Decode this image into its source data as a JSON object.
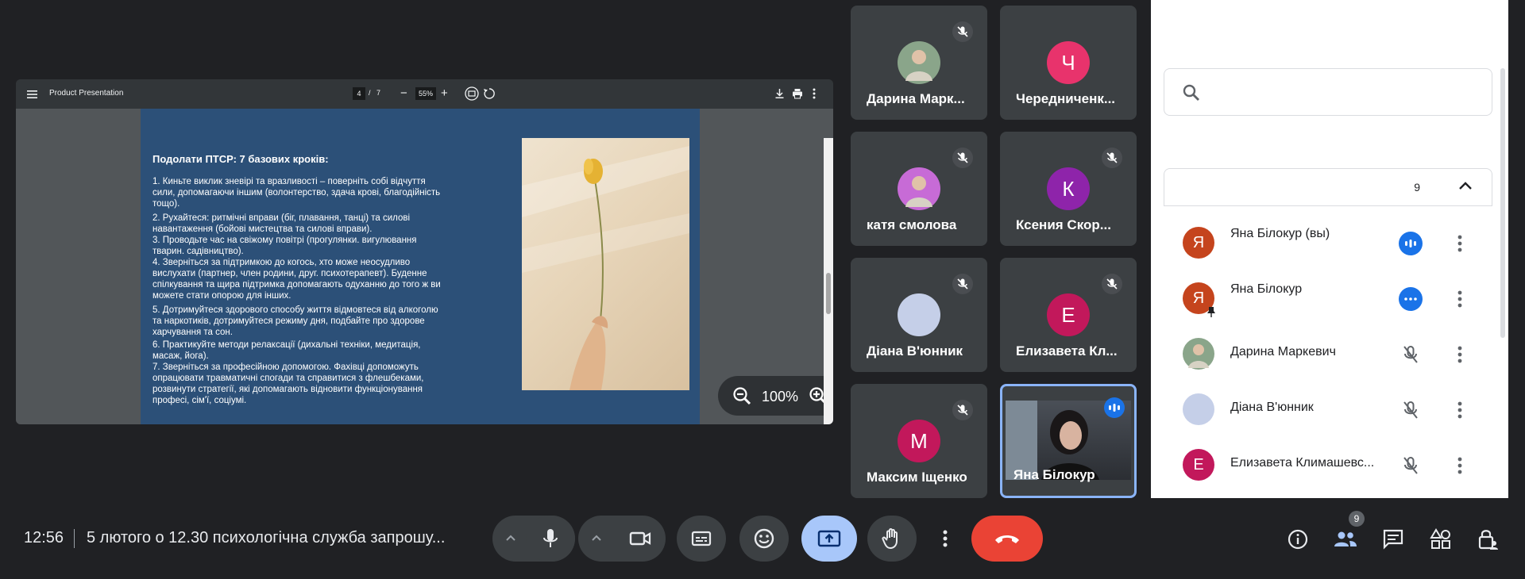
{
  "presentation": {
    "title": "Product Presentation",
    "page_current": "4",
    "page_separator": "/",
    "page_total": "7",
    "zoom_percent": "55%",
    "viewer_zoom": "100%",
    "slide_heading": "Подолати ПТСР: 7 базових кроків:",
    "slide_lines": [
      "1. Киньте виклик зневірі та вразливості – поверніть собі відчуття",
      "сили, допомагаючи іншим (волонтерство, здача крові, благодійність",
      "тощо).",
      "2. Рухайтеся: ритмічні вправи (біг, плавання, танці) та силові",
      "навантаження (бойові мистецтва та силові вправи).",
      "3. Проводьте час на свіжому повітрі (прогулянки. вигулювання",
      "тварин. садівництво).",
      "4. Зверніться за підтримкою до когось, хто може неосудливо",
      "вислухати (партнер, член родини, друг. психотерапевт). Буденне",
      "спілкування та щира підтримка допомагають одуханню до того ж ви",
      "можете стати опорою для інших.",
      "5. Дотримуйтеся здорового способу життя  відмовтеся від алкоголю",
      "та наркотиків, дотримуйтеся режиму дня, подбайте про здорове",
      "харчування та сон.",
      "6. Практикуйте методи релаксації (дихальні техніки, медитація,",
      "масаж, йога).",
      "7. Зверніться за професійною допомогою. Фахівці допоможуть",
      "опрацювати травматичні спогади та справитися з флешбеками,",
      "розвинути  стратегії, які допомагають відновити функціонування",
      "професі, сім'ї, соціумі."
    ]
  },
  "tiles": [
    {
      "name": "Дарина Марк...",
      "initial": "",
      "avatar_color": "#8aa58a",
      "has_photo": true,
      "muted": true
    },
    {
      "name": "Чередниченк...",
      "initial": "Ч",
      "avatar_color": "#e8336c",
      "muted": false
    },
    {
      "name": "катя смолова",
      "initial": "",
      "avatar_color": "#c76bd6",
      "has_photo": true,
      "muted": true
    },
    {
      "name": "Ксения Скор...",
      "initial": "К",
      "avatar_color": "#8e24aa",
      "muted": true
    },
    {
      "name": "Діана В'юнник",
      "initial": "",
      "avatar_color": "#c5cfe8",
      "muted": true
    },
    {
      "name": "Елизавета Кл...",
      "initial": "Е",
      "avatar_color": "#c2185b",
      "muted": true
    },
    {
      "name": "Максим Іщенко",
      "initial": "М",
      "avatar_color": "#c2185b",
      "muted": true
    },
    {
      "name": "Яна Білокур",
      "initial": "",
      "avatar_color": "#333",
      "has_video": true,
      "speaking": true
    }
  ],
  "panel": {
    "group_count": "9",
    "participants": [
      {
        "name": "Яна Білокур (вы)",
        "initial": "Я",
        "color": "#c5441d",
        "status": "speaking"
      },
      {
        "name": "Яна Білокур",
        "initial": "Я",
        "color": "#c5441d",
        "status": "more",
        "pinned": true
      },
      {
        "name": "Дарина Маркевич",
        "initial": "",
        "color": "#8aa58a",
        "status": "muted",
        "photo": true
      },
      {
        "name": "Діана В'юнник",
        "initial": "",
        "color": "#c5cfe8",
        "status": "muted"
      },
      {
        "name": "Елизавета Климашевс...",
        "initial": "Е",
        "color": "#c2185b",
        "status": "muted"
      }
    ]
  },
  "bottom": {
    "time": "12:56",
    "meeting_title": "5 лютого о 12.30 психологічна служба запрошу...",
    "people_badge": "9"
  },
  "colors": {
    "background": "#202124",
    "tile": "#3c4043",
    "present_active": "#a8c7fa",
    "end_call": "#ea4335",
    "speaking": "#1a73e8"
  }
}
